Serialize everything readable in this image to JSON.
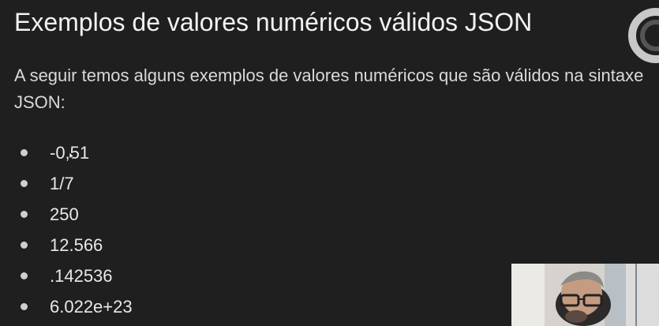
{
  "slide": {
    "title": "Exemplos de valores numéricos válidos JSON",
    "intro": "A seguir temos alguns exemplos de valores numéricos que são válidos na sintaxe JSON:",
    "items": [
      "-0,51",
      "1/7",
      "250",
      "12.566",
      ".142536",
      "6.022e+23"
    ]
  },
  "colors": {
    "background": "#1f1f1f",
    "text": "#f2f2f2",
    "bullet": "#cfcfcf"
  },
  "icons": {
    "cursor": "mouse-pointer-icon",
    "logo": "partial-circular-logo-icon"
  }
}
